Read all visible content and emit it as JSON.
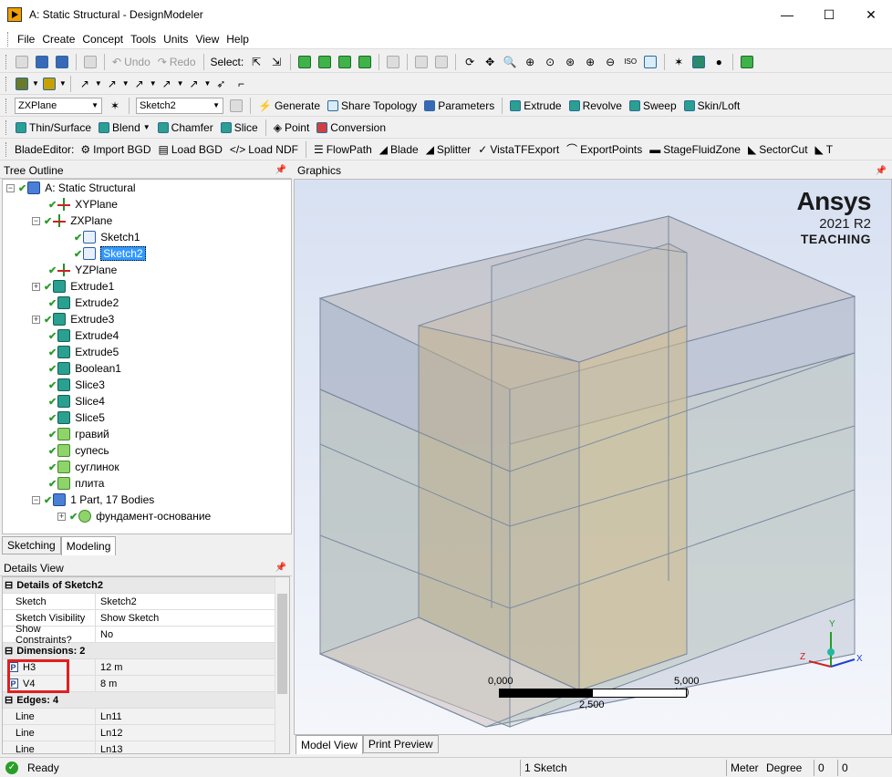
{
  "window": {
    "title": "A: Static Structural - DesignModeler",
    "minimize": "—",
    "maximize": "☐",
    "close": "✕"
  },
  "menu": [
    "File",
    "Create",
    "Concept",
    "Tools",
    "Units",
    "View",
    "Help"
  ],
  "toolbar1": {
    "undo": "Undo",
    "redo": "Redo",
    "select": "Select:"
  },
  "toolbar3": {
    "plane": "ZXPlane",
    "sketch": "Sketch2",
    "generate": "Generate",
    "share_topology": "Share Topology",
    "parameters": "Parameters",
    "extrude": "Extrude",
    "revolve": "Revolve",
    "sweep": "Sweep",
    "skin_loft": "Skin/Loft"
  },
  "toolbar4": {
    "thin_surface": "Thin/Surface",
    "blend": "Blend",
    "chamfer": "Chamfer",
    "slice": "Slice",
    "point": "Point",
    "conversion": "Conversion"
  },
  "toolbar5": {
    "label": "BladeEditor:",
    "import_bgd": "Import BGD",
    "load_bgd": "Load BGD",
    "load_ndf": "Load NDF",
    "flowpath": "FlowPath",
    "blade": "Blade",
    "splitter": "Splitter",
    "vista": "VistaTFExport",
    "export_points": "ExportPoints",
    "stage_fluid_zone": "StageFluidZone",
    "sector_cut": "SectorCut",
    "trunc": "T"
  },
  "tree": {
    "header": "Tree Outline",
    "items": [
      {
        "label": "A: Static Structural"
      },
      {
        "label": "XYPlane"
      },
      {
        "label": "ZXPlane"
      },
      {
        "label": "Sketch1"
      },
      {
        "label": "Sketch2"
      },
      {
        "label": "YZPlane"
      },
      {
        "label": "Extrude1"
      },
      {
        "label": "Extrude2"
      },
      {
        "label": "Extrude3"
      },
      {
        "label": "Extrude4"
      },
      {
        "label": "Extrude5"
      },
      {
        "label": "Boolean1"
      },
      {
        "label": "Slice3"
      },
      {
        "label": "Slice4"
      },
      {
        "label": "Slice5"
      },
      {
        "label": "гравий"
      },
      {
        "label": "супесь"
      },
      {
        "label": "суглинок"
      },
      {
        "label": "плита"
      },
      {
        "label": "1 Part, 17 Bodies"
      },
      {
        "label": "фундамент-основание"
      }
    ]
  },
  "tree_tabs": [
    "Sketching",
    "Modeling"
  ],
  "details": {
    "header": "Details View",
    "title": "Details of Sketch2",
    "rows": [
      {
        "k": "Sketch",
        "v": "Sketch2"
      },
      {
        "k": "Sketch Visibility",
        "v": "Show Sketch"
      },
      {
        "k": "Show Constraints?",
        "v": "No"
      }
    ],
    "dimensions_title": "Dimensions: 2",
    "dimensions": [
      {
        "badge": "P",
        "k": "H3",
        "v": "12 m"
      },
      {
        "badge": "P",
        "k": "V4",
        "v": "8 m"
      }
    ],
    "edges_title": "Edges: 4",
    "edges": [
      {
        "k": "Line",
        "v": "Ln11"
      },
      {
        "k": "Line",
        "v": "Ln12"
      },
      {
        "k": "Line",
        "v": "Ln13"
      }
    ]
  },
  "graphics": {
    "header": "Graphics",
    "brand": {
      "name": "Ansys",
      "version": "2021 R2",
      "edition": "TEACHING"
    },
    "scale": {
      "left": "0,000",
      "right": "5,000 (m)",
      "mid": "2,500"
    },
    "axes": {
      "x": "X",
      "y": "Y",
      "z": "Z"
    },
    "tabs": [
      "Model View",
      "Print Preview"
    ]
  },
  "status": {
    "ready": "Ready",
    "sketch_count": "1 Sketch",
    "unit_length": "Meter",
    "unit_angle": "Degree",
    "val1": "0",
    "val2": "0"
  }
}
